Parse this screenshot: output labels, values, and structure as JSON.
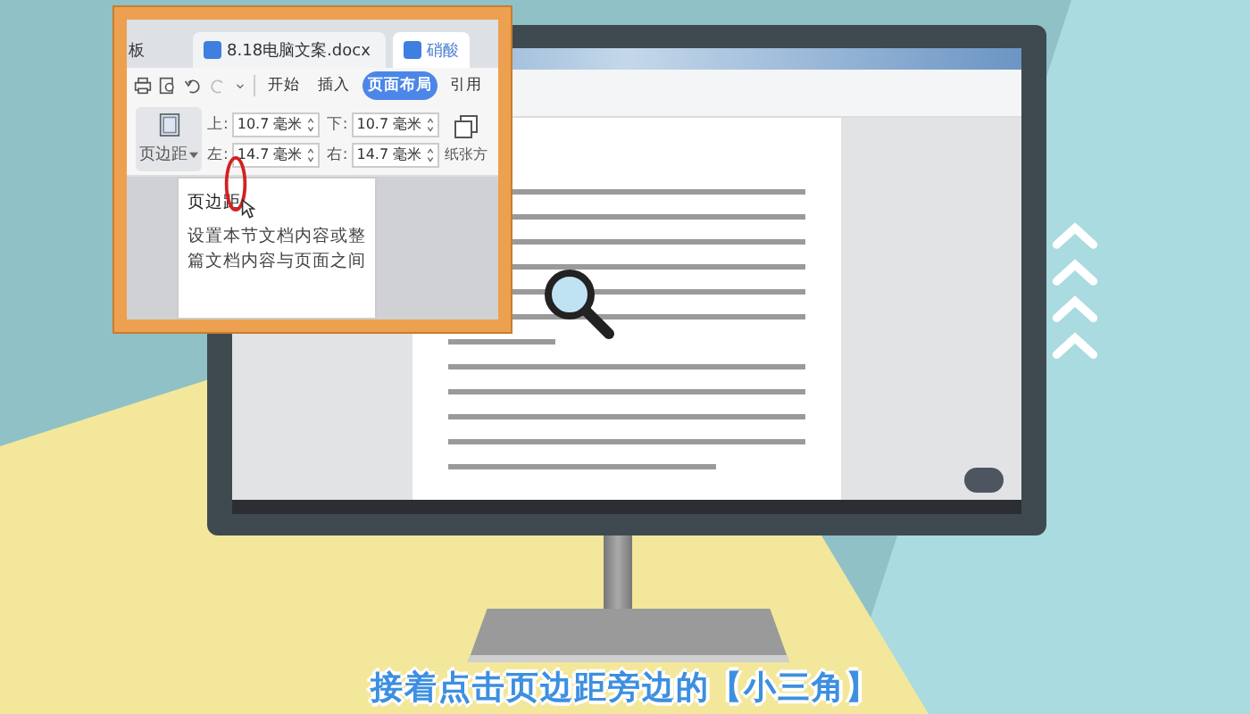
{
  "inset": {
    "tabs": [
      {
        "label": "板",
        "icon": false
      },
      {
        "label": "8.18电脑文案.docx",
        "icon": true
      },
      {
        "label": "硝酸",
        "icon": true
      }
    ],
    "menu": [
      {
        "label": "开始",
        "selected": false
      },
      {
        "label": "插入",
        "selected": false
      },
      {
        "label": "页面布局",
        "selected": true
      },
      {
        "label": "引用",
        "selected": false
      }
    ],
    "margin_button": {
      "label": "页边距"
    },
    "margins": [
      {
        "label": "上:",
        "value": "10.7 毫米"
      },
      {
        "label": "下:",
        "value": "10.7 毫米"
      },
      {
        "label": "左:",
        "value": "14.7 毫米"
      },
      {
        "label": "右:",
        "value": "14.7 毫米"
      }
    ],
    "paper_button": {
      "label": "纸张方"
    },
    "tooltip": {
      "title": "页边距",
      "lines": [
        "设置本节文档内容或整",
        "篇文档内容与页面之间"
      ]
    }
  },
  "caption": "接着点击页边距旁边的【小三角】"
}
